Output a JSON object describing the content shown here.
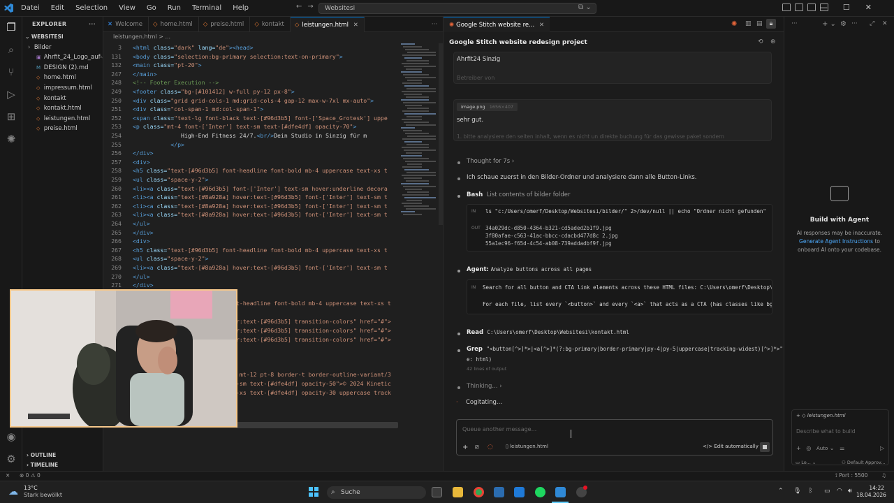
{
  "titlebar": {
    "menu": [
      "Datei",
      "Edit",
      "Selection",
      "View",
      "Go",
      "Run",
      "Terminal",
      "Help"
    ],
    "search": "Websitesi"
  },
  "sidebar": {
    "header": "EXPLORER",
    "root": "WEBSITESI",
    "items": [
      {
        "label": "Bilder",
        "type": "folder"
      },
      {
        "label": "Ahrfit_24_Logo_auf-an...",
        "type": "file"
      },
      {
        "label": "DESIGN (2).md",
        "type": "file"
      },
      {
        "label": "home.html",
        "type": "file"
      },
      {
        "label": "impressum.html",
        "type": "file"
      },
      {
        "label": "kontakt",
        "type": "file"
      },
      {
        "label": "kontakt.html",
        "type": "file"
      },
      {
        "label": "leistungen.html",
        "type": "file"
      },
      {
        "label": "preise.html",
        "type": "file"
      }
    ],
    "outline": "OUTLINE",
    "timeline": "TIMELINE"
  },
  "editor": {
    "tabs": [
      "Welcome",
      "home.html",
      "preise.html",
      "kontakt",
      "leistungen.html"
    ],
    "active_tab": "leistungen.html",
    "breadcrumb": "leistungen.html > ...",
    "lines": [
      {
        "n": "3",
        "segments": [
          {
            "c": "tag",
            "t": "<html "
          },
          {
            "c": "attr",
            "t": "class="
          },
          {
            "c": "str",
            "t": "\"dark\" "
          },
          {
            "c": "attr",
            "t": "lang="
          },
          {
            "c": "str",
            "t": "\"de\""
          },
          {
            "c": "tag",
            "t": "><head>"
          }
        ]
      },
      {
        "n": "131",
        "segments": [
          {
            "c": "tag",
            "t": "<body "
          },
          {
            "c": "attr",
            "t": "class="
          },
          {
            "c": "str",
            "t": "\"selection:bg-primary selection:text-on-primary\""
          },
          {
            "c": "tag",
            "t": ">"
          }
        ]
      },
      {
        "n": "132",
        "segments": [
          {
            "c": "tag",
            "t": "<main "
          },
          {
            "c": "attr",
            "t": "class="
          },
          {
            "c": "str",
            "t": "\"pt-20\""
          },
          {
            "c": "tag",
            "t": ">"
          }
        ]
      },
      {
        "n": "247",
        "segments": [
          {
            "c": "tag",
            "t": "</main>"
          }
        ]
      },
      {
        "n": "248",
        "segments": [
          {
            "c": "cmt",
            "t": "<!-- Footer Execution -->"
          }
        ]
      },
      {
        "n": "249",
        "segments": [
          {
            "c": "tag",
            "t": "<footer "
          },
          {
            "c": "attr",
            "t": "class="
          },
          {
            "c": "str",
            "t": "\"bg-[#101412] w-full py-12 px-8\""
          },
          {
            "c": "tag",
            "t": ">"
          }
        ]
      },
      {
        "n": "250",
        "segments": [
          {
            "c": "tag",
            "t": "<div "
          },
          {
            "c": "attr",
            "t": "class="
          },
          {
            "c": "str",
            "t": "\"grid grid-cols-1 md:grid-cols-4 gap-12 max-w-7xl mx-auto\""
          },
          {
            "c": "tag",
            "t": ">"
          }
        ]
      },
      {
        "n": "251",
        "segments": [
          {
            "c": "tag",
            "t": "<div "
          },
          {
            "c": "attr",
            "t": "class="
          },
          {
            "c": "str",
            "t": "\"col-span-1 md:col-span-1\""
          },
          {
            "c": "tag",
            "t": ">"
          }
        ]
      },
      {
        "n": "252",
        "segments": [
          {
            "c": "tag",
            "t": "<span "
          },
          {
            "c": "attr",
            "t": "class="
          },
          {
            "c": "str",
            "t": "\"text-lg font-black text-[#96d3b5] font-['Space_Grotesk'] uppe"
          }
        ]
      },
      {
        "n": "253",
        "segments": [
          {
            "c": "tag",
            "t": "<p "
          },
          {
            "c": "attr",
            "t": "class="
          },
          {
            "c": "str",
            "t": "\"mt-4 font-['Inter'] text-sm text-[#dfe4df] opacity-70\""
          },
          {
            "c": "tag",
            "t": ">"
          }
        ]
      },
      {
        "n": "254",
        "segments": [
          {
            "c": "txt",
            "t": "              High-End Fitness 24/7."
          },
          {
            "c": "tag",
            "t": "<br/>"
          },
          {
            "c": "txt",
            "t": "Dein Studio in Sinzig für m"
          }
        ]
      },
      {
        "n": "255",
        "segments": [
          {
            "c": "txt",
            "t": "           "
          },
          {
            "c": "tag",
            "t": "</p>"
          }
        ]
      },
      {
        "n": "256",
        "segments": [
          {
            "c": "tag",
            "t": "</div>"
          }
        ]
      },
      {
        "n": "257",
        "segments": [
          {
            "c": "tag",
            "t": "<div>"
          }
        ]
      },
      {
        "n": "258",
        "segments": [
          {
            "c": "tag",
            "t": "<h5 "
          },
          {
            "c": "attr",
            "t": "class="
          },
          {
            "c": "str",
            "t": "\"text-[#96d3b5] font-headline font-bold mb-4 uppercase text-xs t"
          }
        ]
      },
      {
        "n": "259",
        "segments": [
          {
            "c": "tag",
            "t": "<ul "
          },
          {
            "c": "attr",
            "t": "class="
          },
          {
            "c": "str",
            "t": "\"space-y-2\""
          },
          {
            "c": "tag",
            "t": ">"
          }
        ]
      },
      {
        "n": "260",
        "segments": [
          {
            "c": "tag",
            "t": "<li><a "
          },
          {
            "c": "attr",
            "t": "class="
          },
          {
            "c": "str",
            "t": "\"text-[#96d3b5] font-['Inter'] text-sm hover:underline decora"
          }
        ]
      },
      {
        "n": "261",
        "segments": [
          {
            "c": "tag",
            "t": "<li><a "
          },
          {
            "c": "attr",
            "t": "class="
          },
          {
            "c": "str",
            "t": "\"text-[#8a928a] hover:text-[#96d3b5] font-['Inter'] text-sm t"
          }
        ]
      },
      {
        "n": "262",
        "segments": [
          {
            "c": "tag",
            "t": "<li><a "
          },
          {
            "c": "attr",
            "t": "class="
          },
          {
            "c": "str",
            "t": "\"text-[#8a928a] hover:text-[#96d3b5] font-['Inter'] text-sm t"
          }
        ]
      },
      {
        "n": "263",
        "segments": [
          {
            "c": "tag",
            "t": "<li><a "
          },
          {
            "c": "attr",
            "t": "class="
          },
          {
            "c": "str",
            "t": "\"text-[#8a928a] hover:text-[#96d3b5] font-['Inter'] text-sm t"
          }
        ]
      },
      {
        "n": "264",
        "segments": [
          {
            "c": "tag",
            "t": "</ul>"
          }
        ]
      },
      {
        "n": "265",
        "segments": [
          {
            "c": "tag",
            "t": "</div>"
          }
        ]
      },
      {
        "n": "266",
        "segments": [
          {
            "c": "tag",
            "t": "<div>"
          }
        ]
      },
      {
        "n": "267",
        "segments": [
          {
            "c": "tag",
            "t": "<h5 "
          },
          {
            "c": "attr",
            "t": "class="
          },
          {
            "c": "str",
            "t": "\"text-[#96d3b5] font-headline font-bold mb-4 uppercase text-xs t"
          }
        ]
      },
      {
        "n": "268",
        "segments": [
          {
            "c": "tag",
            "t": "<ul "
          },
          {
            "c": "attr",
            "t": "class="
          },
          {
            "c": "str",
            "t": "\"space-y-2\""
          },
          {
            "c": "tag",
            "t": ">"
          }
        ]
      },
      {
        "n": "269",
        "segments": [
          {
            "c": "tag",
            "t": "<li><a "
          },
          {
            "c": "attr",
            "t": "class="
          },
          {
            "c": "str",
            "t": "\"text-[#8a928a] hover:text-[#96d3b5] font-['Inter'] text-sm t"
          }
        ]
      },
      {
        "n": "270",
        "segments": [
          {
            "c": "tag",
            "t": "</ul>"
          }
        ]
      },
      {
        "n": "271",
        "segments": [
          {
            "c": "tag",
            "t": "</div>"
          }
        ]
      }
    ],
    "partial_lines": [
      {
        "t": "t-headline font-bold mb-4 uppercase text-xs t"
      },
      {
        "t": "r:text-[#96d3b5] transition-colors\" href=\"#\">"
      },
      {
        "t": "r:text-[#96d3b5] transition-colors\" href=\"#\">"
      },
      {
        "t": "r:text-[#96d3b5] transition-colors\" href=\"#\">"
      },
      {
        "t": " mt-12 pt-8 border-t border-outline-variant/3"
      },
      {
        "t": "-sm text-[#dfe4df] opacity-50\">© 2024 Kinetic"
      },
      {
        "t": "-xs text-[#dfe4df] opacity-30 uppercase track"
      }
    ]
  },
  "chat": {
    "tab_title": "Google Stitch website re...",
    "title": "Google Stitch website redesign project",
    "msg1": "Ahrfit24 Sinzig",
    "msg1_faded": "Betreiber von",
    "image_label": "image.png",
    "image_size": "1656×407",
    "msg2": "sehr gut.",
    "msg2_faded": "1. bitte analysiere den seiten inhalt, wenn es nicht un direkte buchung für das gewisse paket sondern",
    "thought": "Thought for 7s",
    "narration": "Ich schaue zuerst in den Bilder-Ordner und analysiere dann alle Button-Links.",
    "bash_label": "Bash",
    "bash_desc": "List contents of bilder folder",
    "bash_in_label": "IN",
    "bash_cmd": "ls \"c:/Users/omerf/Desktop/Websitesi/bilder/\" 2>/dev/null || echo \"Ordner nicht gefunden\"",
    "bash_out_label": "OUT",
    "bash_out": [
      "34a029dc-d850-4364-b321-cd5aded2b1f9.jpg",
      "3f80afae-c563-41ac-bbcc-cdacbd477d8c 2.jpg",
      "55a1ec96-f65d-4c54-ab08-739addadbf9f.jpg"
    ],
    "agent_label": "Agent:",
    "agent_desc": "Analyze buttons across all pages",
    "agent_in_label": "IN",
    "agent_line1": "Search for all button and CTA link elements across these HTML files: C:\\Users\\omerf\\Desktop\\Websites",
    "agent_line2": "For each file, list every `<button>` and every `<a>` that acts as a CTA (has classes like bg-primary",
    "read_label": "Read",
    "read_path": "C:\\Users\\omerf\\Desktop\\Websitesi\\kontakt.html",
    "grep_label": "Grep",
    "grep_pattern": "\"<button[^>]*>|<a[^>]*(?:bg-primary|border-primary|py-4|py-5|uppercase|tracking-widest)[^>]*>\" (typ",
    "grep_pattern2": "e: html)",
    "grep_lines": "42 lines of output",
    "thinking": "Thinking...",
    "cogitating": "Cogitating...",
    "composer_placeholder": "Queue another message...",
    "composer_file": "leistungen.html",
    "edit_mode": "Edit automatically"
  },
  "agent_panel": {
    "title": "Build with Agent",
    "line1": "AI responses may be inaccurate.",
    "link": "Generate Agent Instructions",
    "line2_suffix": "to",
    "line3": "onboard AI onto your codebase.",
    "context_file": "leistungen.html",
    "input_placeholder": "Describe what to build",
    "mode": "Auto",
    "approvals": "Default Approv..."
  },
  "statusbar": {
    "errors": "0",
    "warnings": "0",
    "port": "Port : 5500"
  },
  "taskbar": {
    "weather_temp": "13°C",
    "weather_desc": "Stark bewölkt",
    "search": "Suche",
    "time": "14:22",
    "date": "18.04.2026"
  }
}
